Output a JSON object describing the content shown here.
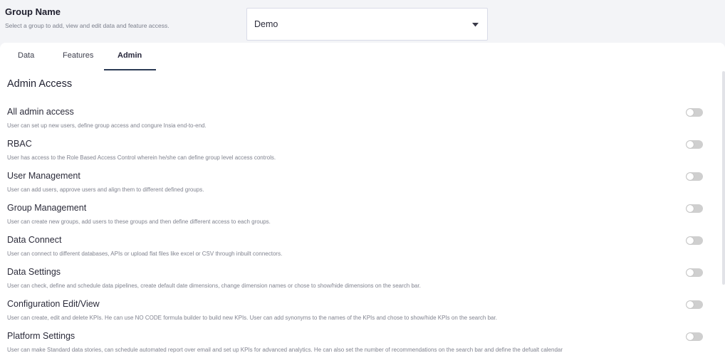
{
  "group": {
    "title": "Group Name",
    "subtitle": "Select a group to add, view and edit data and feature access.",
    "selected": "Demo"
  },
  "tabs": [
    {
      "label": "Data"
    },
    {
      "label": "Features"
    },
    {
      "label": "Admin",
      "active": true
    }
  ],
  "section_title": "Admin Access",
  "permissions": [
    {
      "title": "All admin access",
      "desc": "User can set up new users, define group access and congure Insia end-to-end.",
      "enabled": false
    },
    {
      "title": "RBAC",
      "desc": "User has access to the Role Based Access Control wherein he/she can define group level access controls.",
      "enabled": false
    },
    {
      "title": "User Management",
      "desc": "User can add users, approve users and align them to different defined groups.",
      "enabled": false
    },
    {
      "title": "Group Management",
      "desc": "User can create new groups, add users to these groups and then define different access to each groups.",
      "enabled": false
    },
    {
      "title": "Data Connect",
      "desc": "User can connect to different databases, APIs or upload flat files like excel or CSV through inbuilt connectors.",
      "enabled": false
    },
    {
      "title": "Data Settings",
      "desc": "User can check, define and schedule data pipelines, create default date dimensions, change dimension names or chose to show/hide dimensions on the search bar.",
      "enabled": false
    },
    {
      "title": "Configuration Edit/View",
      "desc": "User can create, edit and delete KPIs. He can use NO CODE formula builder to build new KPIs. User can add synonyms to the names of the KPIs and chose to show/hide KPIs on the search bar.",
      "enabled": false
    },
    {
      "title": "Platform Settings",
      "desc": "User can make Standard data stories, can schedule automated report over email and set up KPIs for advanced analytics. He can also set the number of recommendations on the search bar and define the defualt calendar",
      "enabled": false
    }
  ],
  "colors": {
    "accent": "#2b3a55",
    "toggle_off": "#cfcfcf",
    "background": "#f3f4f7"
  }
}
